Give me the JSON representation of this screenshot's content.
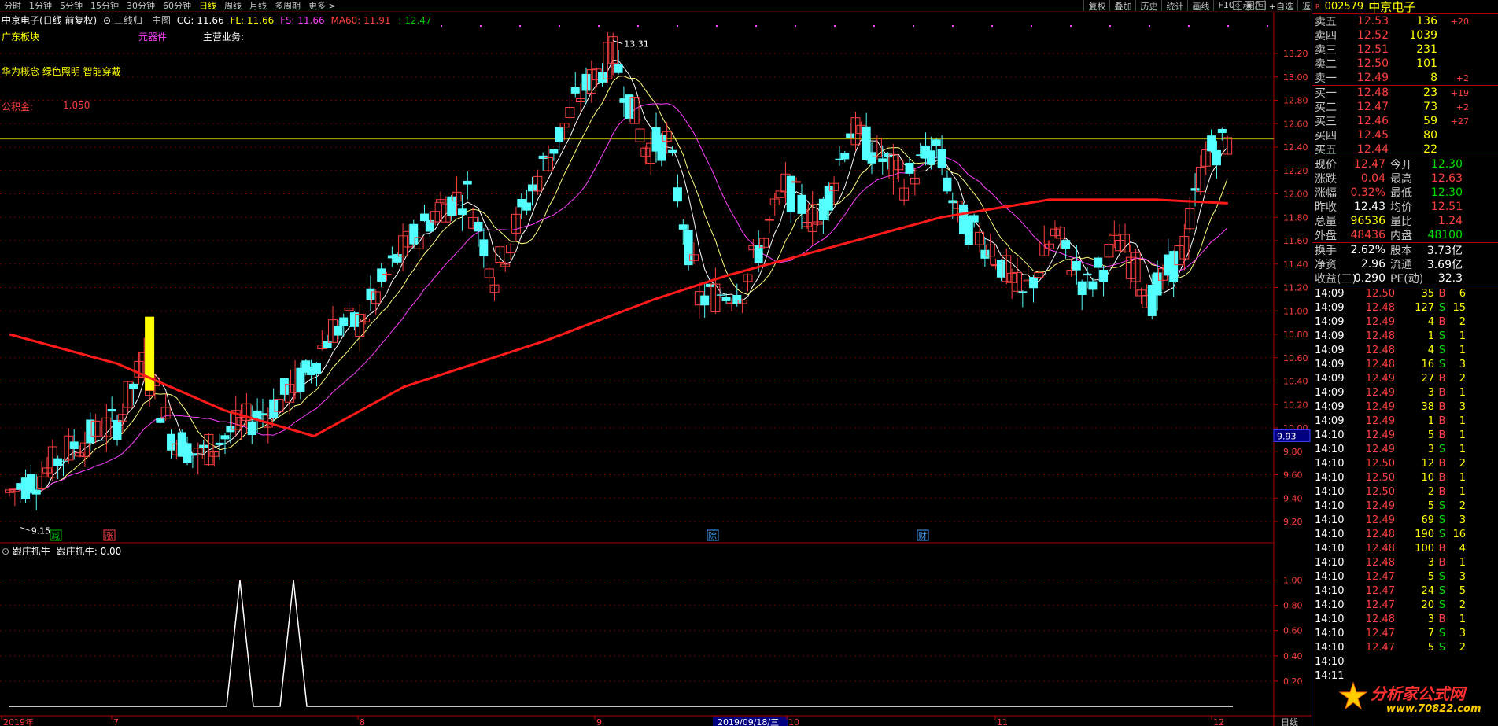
{
  "periods": [
    "分时",
    "1分钟",
    "5分钟",
    "15分钟",
    "30分钟",
    "60分钟",
    "日线",
    "周线",
    "月线",
    "多周期",
    "更多 >"
  ],
  "active_period": "日线",
  "tools": [
    "复权",
    "叠加",
    "历史",
    "统计",
    "画线",
    "F10",
    "标记",
    "+自选",
    "返回"
  ],
  "chart_header": {
    "title": "中京电子(日线 前复权)",
    "indicator": "三线归一主图",
    "cg": "CG: 11.66",
    "fl": "FL: 11.66",
    "fs": "FS: 11.66",
    "ma60": "MA60: 11.91",
    "extra": ": 12.47"
  },
  "info": {
    "sector": "广东板块",
    "category": "元器件",
    "business_label": "主营业务:",
    "concepts": "华为概念 绿色照明 智能穿戴",
    "fund_label": "公积金:",
    "fund_value": "1.050"
  },
  "price_axis": {
    "ticks": [
      "13.20",
      "13.00",
      "12.80",
      "12.60",
      "12.40",
      "12.20",
      "12.00",
      "11.80",
      "11.60",
      "11.40",
      "11.20",
      "11.00",
      "10.80",
      "10.60",
      "10.40",
      "10.20",
      "10.00",
      "9.80",
      "9.60",
      "9.40",
      "9.20"
    ],
    "current_marker": "9.93"
  },
  "annotations": {
    "high": "13.31",
    "low": "9.15"
  },
  "event_markers": [
    "减",
    "涨",
    "除",
    "财"
  ],
  "sub_chart": {
    "title": "跟庄抓牛",
    "value_label": "跟庄抓牛: 0.00",
    "ticks": [
      "1.00",
      "0.80",
      "0.60",
      "0.40",
      "0.20"
    ]
  },
  "date_axis": [
    "2019年",
    "7",
    "8",
    "9",
    "2019/09/18/三",
    "10",
    "11",
    "12"
  ],
  "bottom_right": "日线",
  "quote": {
    "code": "002579",
    "name": "中京电子",
    "asks": [
      {
        "label": "卖五",
        "price": "12.53",
        "vol": "136",
        "chg": "+20"
      },
      {
        "label": "卖四",
        "price": "12.52",
        "vol": "1039",
        "chg": ""
      },
      {
        "label": "卖三",
        "price": "12.51",
        "vol": "231",
        "chg": ""
      },
      {
        "label": "卖二",
        "price": "12.50",
        "vol": "101",
        "chg": ""
      },
      {
        "label": "卖一",
        "price": "12.49",
        "vol": "8",
        "chg": "+2"
      }
    ],
    "bids": [
      {
        "label": "买一",
        "price": "12.48",
        "vol": "23",
        "chg": "+19"
      },
      {
        "label": "买二",
        "price": "12.47",
        "vol": "73",
        "chg": "+2"
      },
      {
        "label": "买三",
        "price": "12.46",
        "vol": "59",
        "chg": "+27"
      },
      {
        "label": "买四",
        "price": "12.45",
        "vol": "80",
        "chg": ""
      },
      {
        "label": "买五",
        "price": "12.44",
        "vol": "22",
        "chg": ""
      }
    ],
    "stats": [
      {
        "l1": "现价",
        "v1": "12.47",
        "c1": "red",
        "l2": "今开",
        "v2": "12.30",
        "c2": "green"
      },
      {
        "l1": "涨跌",
        "v1": "0.04",
        "c1": "red",
        "l2": "最高",
        "v2": "12.63",
        "c2": "red"
      },
      {
        "l1": "涨幅",
        "v1": "0.32%",
        "c1": "red",
        "l2": "最低",
        "v2": "12.30",
        "c2": "green"
      },
      {
        "l1": "昨收",
        "v1": "12.43",
        "c1": "white",
        "l2": "均价",
        "v2": "12.51",
        "c2": "red"
      },
      {
        "l1": "总量",
        "v1": "96536",
        "c1": "yellow",
        "l2": "量比",
        "v2": "1.24",
        "c2": "red"
      },
      {
        "l1": "外盘",
        "v1": "48436",
        "c1": "red",
        "l2": "内盘",
        "v2": "48100",
        "c2": "green"
      }
    ],
    "stats2": [
      {
        "l1": "换手",
        "v1": "2.62%",
        "l2": "股本",
        "v2": "3.73亿"
      },
      {
        "l1": "净资",
        "v1": "2.96",
        "l2": "流通",
        "v2": "3.69亿"
      },
      {
        "l1": "收益(三)",
        "v1": "0.290",
        "l2": "PE(动)",
        "v2": "32.3"
      }
    ],
    "ticks": [
      {
        "t": "14:09",
        "p": "12.50",
        "v": "35",
        "d": "B",
        "n": "6"
      },
      {
        "t": "14:09",
        "p": "12.48",
        "v": "127",
        "d": "S",
        "n": "15"
      },
      {
        "t": "14:09",
        "p": "12.49",
        "v": "4",
        "d": "B",
        "n": "2"
      },
      {
        "t": "14:09",
        "p": "12.48",
        "v": "1",
        "d": "S",
        "n": "1"
      },
      {
        "t": "14:09",
        "p": "12.48",
        "v": "4",
        "d": "S",
        "n": "1"
      },
      {
        "t": "14:09",
        "p": "12.48",
        "v": "16",
        "d": "S",
        "n": "3"
      },
      {
        "t": "14:09",
        "p": "12.49",
        "v": "27",
        "d": "B",
        "n": "2"
      },
      {
        "t": "14:09",
        "p": "12.49",
        "v": "3",
        "d": "B",
        "n": "1"
      },
      {
        "t": "14:09",
        "p": "12.49",
        "v": "38",
        "d": "B",
        "n": "3"
      },
      {
        "t": "14:09",
        "p": "12.49",
        "v": "1",
        "d": "B",
        "n": "1"
      },
      {
        "t": "14:10",
        "p": "12.49",
        "v": "5",
        "d": "B",
        "n": "1"
      },
      {
        "t": "14:10",
        "p": "12.49",
        "v": "3",
        "d": "S",
        "n": "1"
      },
      {
        "t": "14:10",
        "p": "12.50",
        "v": "12",
        "d": "B",
        "n": "2"
      },
      {
        "t": "14:10",
        "p": "12.50",
        "v": "10",
        "d": "B",
        "n": "1"
      },
      {
        "t": "14:10",
        "p": "12.50",
        "v": "2",
        "d": "B",
        "n": "1"
      },
      {
        "t": "14:10",
        "p": "12.49",
        "v": "5",
        "d": "S",
        "n": "2"
      },
      {
        "t": "14:10",
        "p": "12.49",
        "v": "69",
        "d": "S",
        "n": "3"
      },
      {
        "t": "14:10",
        "p": "12.48",
        "v": "190",
        "d": "S",
        "n": "16"
      },
      {
        "t": "14:10",
        "p": "12.48",
        "v": "100",
        "d": "B",
        "n": "4"
      },
      {
        "t": "14:10",
        "p": "12.48",
        "v": "3",
        "d": "B",
        "n": "1"
      },
      {
        "t": "14:10",
        "p": "12.47",
        "v": "5",
        "d": "S",
        "n": "3"
      },
      {
        "t": "14:10",
        "p": "12.47",
        "v": "24",
        "d": "S",
        "n": "5"
      },
      {
        "t": "14:10",
        "p": "12.47",
        "v": "20",
        "d": "S",
        "n": "2"
      },
      {
        "t": "14:10",
        "p": "12.48",
        "v": "3",
        "d": "B",
        "n": "1"
      },
      {
        "t": "14:10",
        "p": "12.47",
        "v": "7",
        "d": "S",
        "n": "3"
      },
      {
        "t": "14:10",
        "p": "12.47",
        "v": "5",
        "d": "S",
        "n": "2"
      },
      {
        "t": "14:10",
        "p": "",
        "v": "",
        "d": "",
        "n": ""
      },
      {
        "t": "14:11",
        "p": "",
        "v": "",
        "d": "",
        "n": ""
      }
    ]
  },
  "watermark": {
    "text": "分析家公式网",
    "url": "www.70822.com"
  },
  "colors": {
    "up": "#ff4040",
    "down": "#54ffff",
    "ma60": "#ff1a1a",
    "bg": "#000000",
    "grid": "#6b0000"
  }
}
